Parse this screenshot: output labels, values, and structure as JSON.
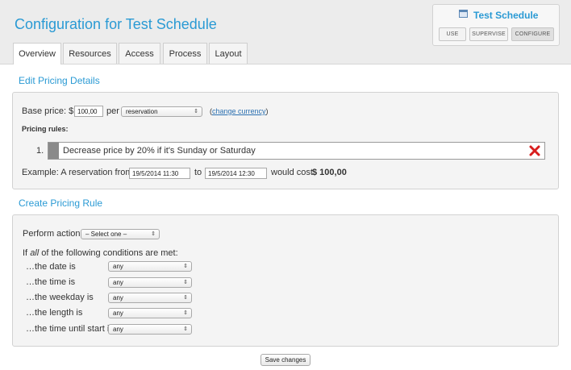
{
  "page_title": "Configuration for Test Schedule",
  "tabs": [
    {
      "label": "Overview",
      "active": true
    },
    {
      "label": "Resources",
      "active": false
    },
    {
      "label": "Access",
      "active": false
    },
    {
      "label": "Process",
      "active": false
    },
    {
      "label": "Layout",
      "active": false
    }
  ],
  "schedule_box": {
    "title": "Test Schedule",
    "icon": "calendar-icon",
    "modes": [
      "USE",
      "SUPERVISE",
      "CONFIGURE"
    ],
    "active_mode": "CONFIGURE"
  },
  "edit_pricing": {
    "title": "Edit Pricing Details",
    "base_price_label": "Base price: $",
    "base_price_value": "100,00",
    "per_label": "per",
    "per_select": "reservation",
    "change_currency_open": "(",
    "change_currency_link": "change currency",
    "change_currency_close": ")",
    "pricing_rules_label": "Pricing rules:",
    "rules": [
      {
        "number": "1.",
        "text": "Decrease price by 20% if it's Sunday or Saturday"
      }
    ],
    "example_label": "Example: A reservation from",
    "example_from": "19/5/2014 11:30",
    "example_to_label": "to",
    "example_to": "19/5/2014 12:30",
    "would_cost_label": "would cost",
    "cost_value": "$ 100,00"
  },
  "create_rule": {
    "title": "Create Pricing Rule",
    "perform_action_label": "Perform action:",
    "perform_action_select": "– Select one –",
    "conditions_pre": "If",
    "conditions_em": "all",
    "conditions_post": "of the following conditions are met:",
    "conditions": [
      {
        "label": "…the date is",
        "value": "any"
      },
      {
        "label": "…the time is",
        "value": "any"
      },
      {
        "label": "…the weekday is",
        "value": "any"
      },
      {
        "label": "…the length is",
        "value": "any"
      },
      {
        "label": "…the time until start is",
        "value": "any"
      }
    ]
  },
  "save_button": "Save changes",
  "colors": {
    "accent": "#2a9ad4",
    "delete": "#d81e1e",
    "panel": "#f4f4f4"
  }
}
